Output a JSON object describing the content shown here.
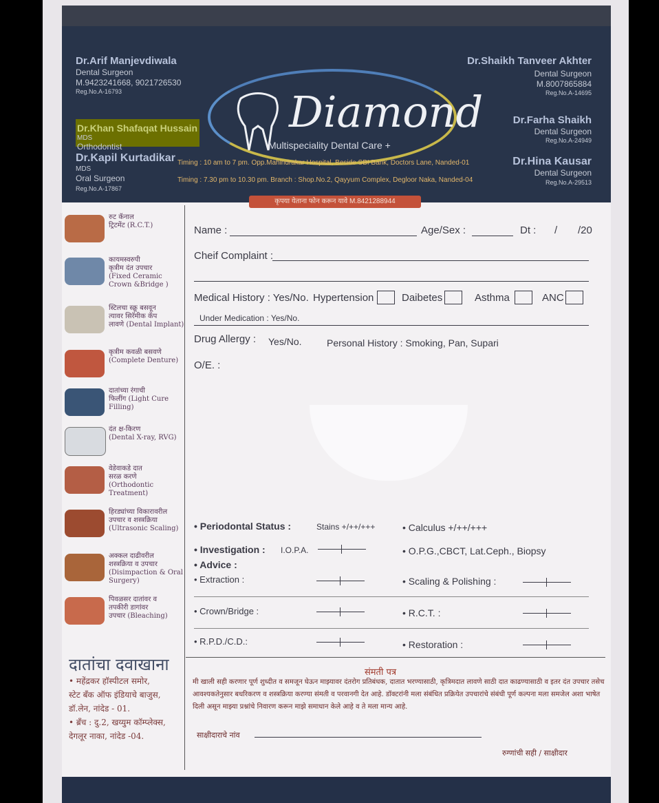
{
  "header": {
    "left": {
      "d1_name": "Dr.Arif Manjevdiwala",
      "d1_title": "Dental Surgeon",
      "d1_phone": "M.9423241668, 9021726530",
      "d1_reg": "Reg.No.A-16793",
      "d2_name": "Dr.Khan Shafaqat Hussain",
      "d2_deg": "MDS",
      "d2_title": "Orthodontist",
      "d3_name": "Dr.Kapil Kurtadikar",
      "d3_deg": "MDS",
      "d3_title": "Oral Surgeon",
      "d3_reg": "Reg.No.A-17867"
    },
    "right": {
      "d4_name": "Dr.Shaikh Tanveer Akhter",
      "d4_title": "Dental Surgeon",
      "d4_phone": "M.8007865884",
      "d4_reg": "Reg.No.A-14695",
      "d5_name": "Dr.Farha Shaikh",
      "d5_title": "Dental Surgeon",
      "d5_reg": "Reg.No.A-24949",
      "d6_name": "Dr.Hina Kausar",
      "d6_title": "Dental Surgeon",
      "d6_reg": "Reg.No.A-29513"
    },
    "logo_word": "Diamond",
    "logo_sub": "Multispeciality Dental Care +",
    "timing1": "Timing : 10 am to 7 pm. Opp.Mahindrakar Hospital, Beside SBI Bank, Doctors Lane, Nanded-01",
    "timing2": "Timing : 7.30 pm to 10.30 pm. Branch : Shop.No.2, Qayyum Complex, Degloor Naka, Nanded-04",
    "phone_band": "कृपया येताना फोन करून यावे M.8421288944"
  },
  "services": [
    "रुट कॅनाल\nट्रिटमेंट (R.C.T.)",
    "कायमस्वरुपी\nकृत्रीम दंत उपचार\n(Fixed Ceramic\nCrown &Bridge )",
    "स्टिलचा स्क्रू बसवून\nत्यावर सिरॅमीक कॅप\nलावणे (Dental Implant)",
    "कृत्रीम कवळी बसवणे\n(Complete Denture)",
    "दातांच्या रंगाची\nफिलींग (Light Cure Filling)",
    "दंत क्ष-किरण\n(Dental X-ray, RVG)",
    "वेडेवाकडे दात\nसरळ करणे\n(Orthodontic Treatment)",
    "हिरड्यांच्या विकारावरील\nउपचार व शस्त्रक्रिया\n(Ultrasonic Scaling)",
    "अक्कल दाढीवरील\nशस्त्रक्रिया व उपचार\n(Disimpaction & Oral Surgery)",
    "पिवळसर दातांवर व\nतपकीरी डागांवर\nउपचार (Bleaching)"
  ],
  "clinic": {
    "title": "दातांचा दवाखाना",
    "addr1": "• महेंद्रकर हॉस्पीटल समोर,",
    "addr2": "स्टेट बँक ऑफ इंडियाचे बाजुस,",
    "addr3": "डॉ.लेन, नांदेड - 01.",
    "addr4": "• ब्रँच : दु.2, खय्युम कॉम्प्लेक्स,",
    "addr5": "देगलूर नाका, नांदेड -04."
  },
  "form": {
    "name": "Name :",
    "agesex": "Age/Sex :",
    "dt": "Dt :",
    "slash1": "/",
    "yr": "/20",
    "complaint": "Cheif Complaint :",
    "medhist": "Medical History : Yes/No.",
    "hyper": "Hypertension",
    "diabetes": "Daibetes",
    "asthma": "Asthma",
    "anc": "ANC",
    "undermed": "Under Medication : Yes/No.",
    "drug": "Drug Allergy :",
    "drug_yn": "Yes/No.",
    "personal": "Personal History : Smoking, Pan, Supari",
    "oe": "O/E. :",
    "perio": "Periodontal Status :",
    "perio_val": "Stains +/++/+++",
    "calculus": "Calculus +/++/+++",
    "invest": "Investigation :",
    "iopa": "I.O.P.A.",
    "opg": "O.P.G.,CBCT, Lat.Ceph., Biopsy",
    "advice": "Advice :",
    "extraction": "Extraction :",
    "scaling": "Scaling & Polishing :",
    "crown": "Crown/Bridge :",
    "rct": "R.C.T. :",
    "rpd": "R.P.D./C.D.:",
    "restoration": "Restoration :"
  },
  "consent": {
    "heading": "संमती पत्र",
    "body": "मी खाली सही करणार पूर्ण शुध्दीत व समजून घेऊन माझ्यावर दंतरोग प्रतिबंधक, दातात भरण्यासाठी, कृत्रिमदात लावणे साठी दात काढण्यासाठी व इतर दंत उपचार तसेच आवश्यकतेनुसार बधरिकरण व शस्त्रक्रिया करण्या संमती व परवानगी देत आहे. डॉक्टरांनी मला संबंधित प्रक्रियेत उपचारांचे संबंधी पूर्ण कल्पना मला समजेल अशा भाषेत दिली असून माझ्या प्रश्नांचे निवारण करून माझे समाधान केले आहे व ते मला मान्य आहे.",
    "witness": "साक्षीदाराचे नांव",
    "patient_sign": "रुग्णांची सही / साक्षीदार"
  }
}
